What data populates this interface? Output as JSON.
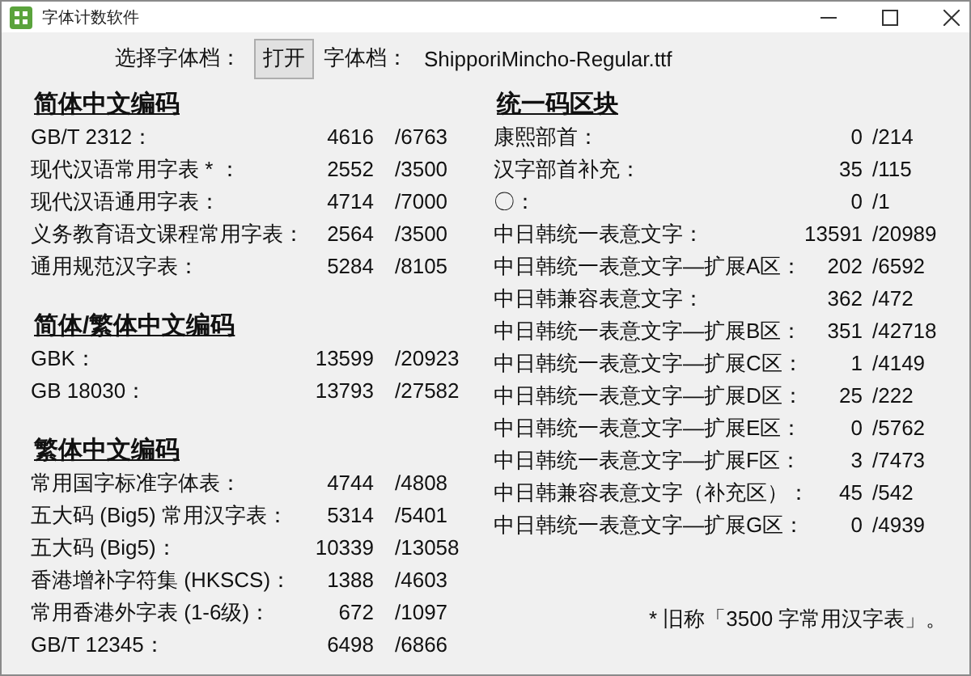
{
  "window": {
    "title": "字体计数软件"
  },
  "toolbar": {
    "label": "选择字体档：",
    "open_button": "打开",
    "file_label": "字体档：",
    "file_name": "ShipporiMincho-Regular.ttf"
  },
  "left_sections": [
    {
      "heading": "简体中文编码",
      "rows": [
        {
          "label": "GB/T 2312：",
          "count": "4616",
          "total": "/6763"
        },
        {
          "label": "现代汉语常用字表 * ：",
          "count": "2552",
          "total": "/3500"
        },
        {
          "label": "现代汉语通用字表：",
          "count": "4714",
          "total": "/7000"
        },
        {
          "label": "义务教育语文课程常用字表：",
          "count": "2564",
          "total": "/3500"
        },
        {
          "label": "通用规范汉字表：",
          "count": "5284",
          "total": "/8105"
        }
      ]
    },
    {
      "heading": "简体/繁体中文编码",
      "rows": [
        {
          "label": "GBK：",
          "count": "13599",
          "total": "/20923"
        },
        {
          "label": "GB 18030：",
          "count": "13793",
          "total": "/27582"
        }
      ]
    },
    {
      "heading": "繁体中文编码",
      "rows": [
        {
          "label": "常用国字标准字体表：",
          "count": "4744",
          "total": "/4808"
        },
        {
          "label": "五大码 (Big5) 常用汉字表：",
          "count": "5314",
          "total": "/5401"
        },
        {
          "label": "五大码 (Big5)：",
          "count": "10339",
          "total": "/13058"
        },
        {
          "label": "香港增补字符集 (HKSCS)：",
          "count": "1388",
          "total": "/4603"
        },
        {
          "label": "常用香港外字表 (1-6级)：",
          "count": "672",
          "total": "/1097"
        },
        {
          "label": "GB/T 12345：",
          "count": "6498",
          "total": "/6866"
        }
      ]
    }
  ],
  "right_sections": [
    {
      "heading": "统一码区块",
      "rows": [
        {
          "label": "康熙部首：",
          "count": "0",
          "total": "/214"
        },
        {
          "label": "汉字部首补充：",
          "count": "35",
          "total": "/115"
        },
        {
          "label": "〇：",
          "count": "0",
          "total": "/1"
        },
        {
          "label": "中日韩统一表意文字：",
          "count": "13591",
          "total": "/20989"
        },
        {
          "label": "中日韩统一表意文字—扩展A区：",
          "count": "202",
          "total": "/6592"
        },
        {
          "label": "中日韩兼容表意文字：",
          "count": "362",
          "total": "/472"
        },
        {
          "label": "中日韩统一表意文字—扩展B区：",
          "count": "351",
          "total": "/42718"
        },
        {
          "label": "中日韩统一表意文字—扩展C区：",
          "count": "1",
          "total": "/4149"
        },
        {
          "label": "中日韩统一表意文字—扩展D区：",
          "count": "25",
          "total": "/222"
        },
        {
          "label": "中日韩统一表意文字—扩展E区：",
          "count": "0",
          "total": "/5762"
        },
        {
          "label": "中日韩统一表意文字—扩展F区：",
          "count": "3",
          "total": "/7473"
        },
        {
          "label": "中日韩兼容表意文字（补充区）：",
          "count": "45",
          "total": "/542"
        },
        {
          "label": "中日韩统一表意文字—扩展G区：",
          "count": "0",
          "total": "/4939"
        }
      ]
    }
  ],
  "footnote": "* 旧称「3500 字常用汉字表」。"
}
